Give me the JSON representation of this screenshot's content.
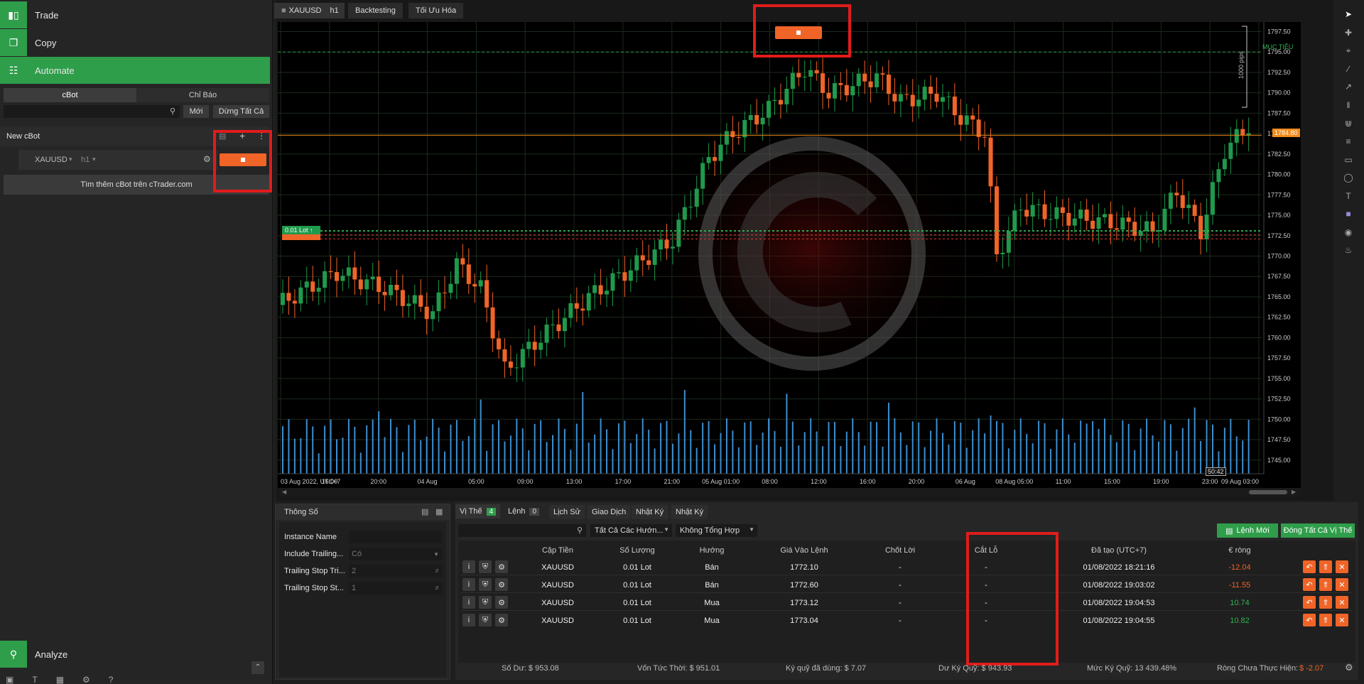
{
  "sidebar": {
    "nav": [
      {
        "label": "Trade",
        "icon": "candlestick-icon"
      },
      {
        "label": "Copy",
        "icon": "copy-icon"
      },
      {
        "label": "Automate",
        "icon": "robot-icon"
      }
    ],
    "tabs": [
      "cBot",
      "Chỉ Báo"
    ],
    "new_button": "Mới",
    "stop_all_button": "Dừng Tất Cả",
    "cbot_name": "New cBot",
    "instance_symbol": "XAUUSD",
    "instance_timeframe": "h1",
    "find_more": "Tìm thêm cBot trên cTrader.com",
    "analyze": "Analyze"
  },
  "chart_tabs": {
    "symbol": "XAUUSD",
    "timeframe": "h1",
    "backtesting": "Backtesting",
    "optimize": "Tối Ưu Hóa"
  },
  "chart": {
    "target_label": "MỤC TIÊU",
    "pips_label": "1000 pips",
    "current_price": "1784.80",
    "lot_label": "0.01 Lot",
    "time_badge": "50:42",
    "y_ticks": [
      "1797.50",
      "1795.00",
      "1792.50",
      "1790.00",
      "1787.50",
      "1785.00",
      "1782.50",
      "1780.00",
      "1777.50",
      "1775.00",
      "1772.50",
      "1770.00",
      "1767.50",
      "1765.00",
      "1762.50",
      "1760.00",
      "1757.50",
      "1755.00",
      "1752.50",
      "1750.00",
      "1747.50",
      "1745.00"
    ],
    "x_ticks": [
      "03 Aug 2022, UTC+7",
      "16:00",
      "20:00",
      "04 Aug",
      "05:00",
      "09:00",
      "13:00",
      "17:00",
      "21:00",
      "05 Aug 01:00",
      "08:00",
      "12:00",
      "16:00",
      "20:00",
      "06 Aug",
      "08 Aug 05:00",
      "11:00",
      "15:00",
      "19:00",
      "23:00",
      "09 Aug 03:00"
    ]
  },
  "params": {
    "title": "Thông Số",
    "rows": [
      {
        "label": "Instance Name",
        "value": ""
      },
      {
        "label": "Include Trailing...",
        "value": "Có"
      },
      {
        "label": "Trailing Stop Tri...",
        "value": "2"
      },
      {
        "label": "Trailing Stop St...",
        "value": "1"
      }
    ]
  },
  "positions": {
    "tabs": [
      {
        "label": "Vị Thế",
        "badge": "4"
      },
      {
        "label": "Lệnh",
        "badge": "0"
      },
      {
        "label": "Lịch Sử"
      },
      {
        "label": "Giao Dịch"
      },
      {
        "label": "Nhật Ký"
      },
      {
        "label": "Nhật Ký"
      }
    ],
    "filter_direction": "Tất Cả Các Hướn...",
    "filter_group": "Không Tổng Hợp",
    "new_order": "Lệnh Mới",
    "close_all": "Đóng Tất Cả Vị Thế",
    "headers": [
      "Cặp Tiền",
      "Số Lượng",
      "Hướng",
      "Giá Vào Lệnh",
      "Chốt Lời",
      "Cắt Lỗ",
      "Đã tạo (UTC+7)",
      "€ ròng"
    ],
    "rows": [
      {
        "symbol": "XAUUSD",
        "qty": "0.01 Lot",
        "dir": "Bán",
        "entry": "1772.10",
        "tp": "-",
        "sl": "-",
        "created": "01/08/2022 18:21:16",
        "net": "-12.04"
      },
      {
        "symbol": "XAUUSD",
        "qty": "0.01 Lot",
        "dir": "Bán",
        "entry": "1772.60",
        "tp": "-",
        "sl": "-",
        "created": "01/08/2022 19:03:02",
        "net": "-11.55"
      },
      {
        "symbol": "XAUUSD",
        "qty": "0.01 Lot",
        "dir": "Mua",
        "entry": "1773.12",
        "tp": "-",
        "sl": "-",
        "created": "01/08/2022 19:04:53",
        "net": "10.74"
      },
      {
        "symbol": "XAUUSD",
        "qty": "0.01 Lot",
        "dir": "Mua",
        "entry": "1773.04",
        "tp": "-",
        "sl": "-",
        "created": "01/08/2022 19:04:55",
        "net": "10.82"
      }
    ]
  },
  "status": {
    "balance": "Số Dư: $ 953.08",
    "equity": "Vốn Tức Thời: $ 951.01",
    "margin_used": "Ký quỹ đã dùng: $ 7.07",
    "free_margin": "Dư Ký Quỹ: $ 943.93",
    "margin_level": "Mức Ký Quỹ: 13 439.48%",
    "unrealized_label": "Ròng Chưa Thực Hiện:",
    "unrealized_value": "$ -2.07"
  },
  "colors": {
    "accent_green": "#2f9e4a",
    "bull": "#1f9a4c",
    "bear": "#f06428",
    "volume": "#3e8ed0"
  }
}
